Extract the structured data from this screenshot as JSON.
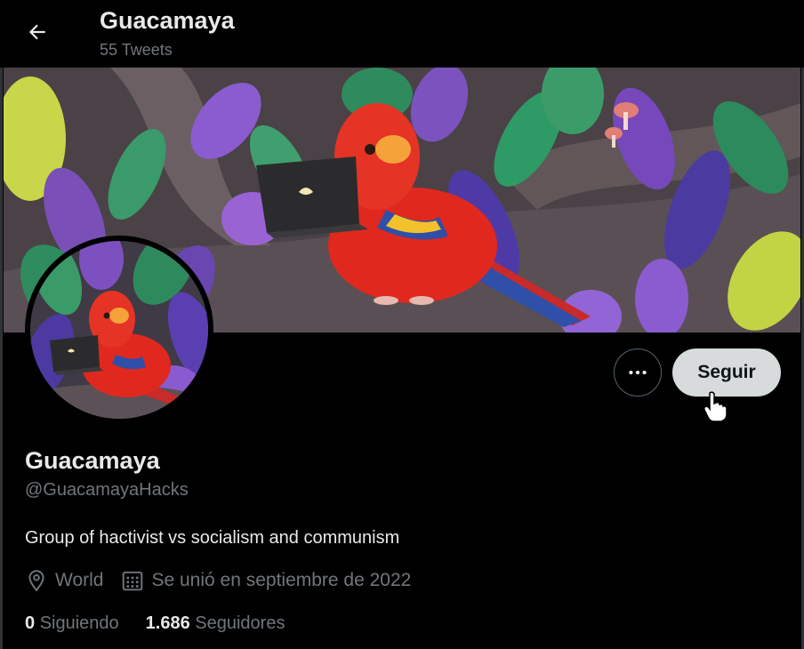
{
  "header": {
    "title": "Guacamaya",
    "subtitle": "55 Tweets"
  },
  "icons": {
    "back": "arrow-left-icon",
    "more": "more-horizontal-icon",
    "location": "location-pin-icon",
    "calendar": "calendar-icon",
    "cursor": "hand-pointer-cursor"
  },
  "actions": {
    "follow_label": "Seguir"
  },
  "profile": {
    "name": "Guacamaya",
    "handle": "@GuacamayaHacks",
    "bio": "Group of hactivist vs socialism and communism",
    "location": "World",
    "joined": "Se unió en septiembre de 2022"
  },
  "stats": {
    "following_count": "0",
    "following_label": "Siguiendo",
    "followers_count": "1.686",
    "followers_label": "Seguidores"
  },
  "colors": {
    "background": "#000000",
    "text_primary": "#e7e9ea",
    "text_secondary": "#71767b",
    "follow_button_bg": "#d7dbdc",
    "parrot_red": "#e0281f"
  }
}
